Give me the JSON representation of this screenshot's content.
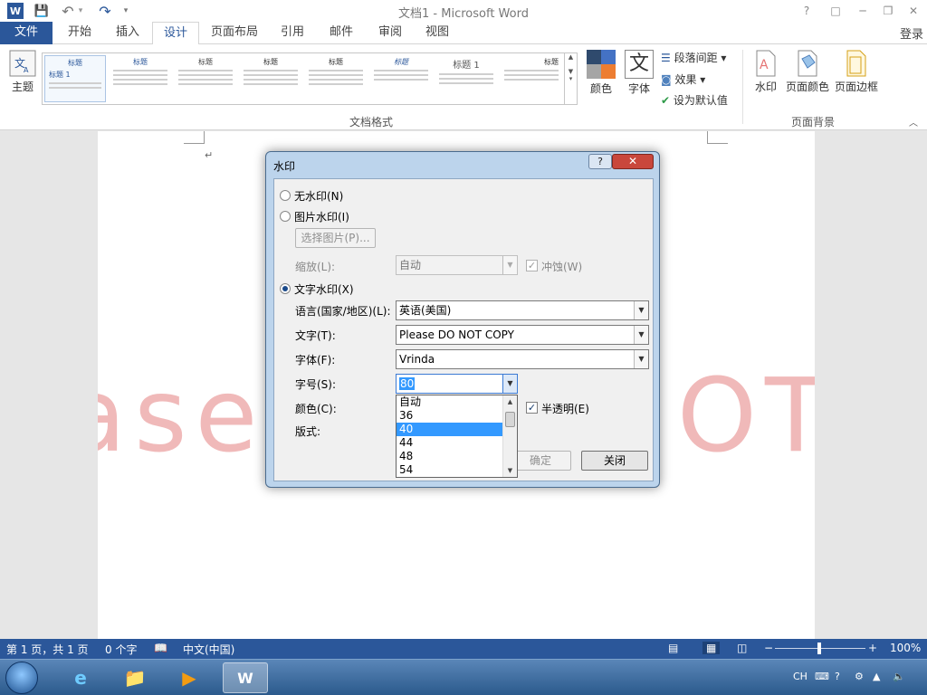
{
  "titlebar": {
    "title": "文档1 - Microsoft Word",
    "help": "?",
    "restore_ribbon": "□",
    "minimize": "─",
    "maximize": "❐",
    "close": "✕"
  },
  "qat": {
    "word_logo": "W",
    "save": "💾",
    "undo": "↶",
    "undo_drop": "▾",
    "redo": "↷",
    "customize": "▾"
  },
  "tabs": [
    "文件",
    "开始",
    "插入",
    "设计",
    "页面布局",
    "引用",
    "邮件",
    "审阅",
    "视图"
  ],
  "signin": "登录",
  "ribbon": {
    "theme_label": "主题",
    "gallery_items": [
      "标题",
      "标题 1",
      "标题",
      "标题",
      "标题",
      "标题",
      "标题",
      "标题 1",
      "标题"
    ],
    "colors_label": "颜色",
    "fonts_label": "字体",
    "fonts_glyph": "文",
    "para_spacing": "段落间距",
    "effects": "效果",
    "set_default": "设为默认值",
    "group_doc_format": "文档格式",
    "watermark_label": "水印",
    "page_color_label": "页面颜色",
    "page_border_label": "页面边框",
    "group_page_bg": "页面背景"
  },
  "document": {
    "para_mark": "↵",
    "watermark_text": "Please DO NOT COPY"
  },
  "dialog": {
    "title": "水印",
    "help": "?",
    "close": "✕",
    "no_watermark": "无水印(N)",
    "picture_watermark": "图片水印(I)",
    "select_picture": "选择图片(P)...",
    "scale_label": "缩放(L):",
    "scale_value": "自动",
    "washout_label": "冲蚀(W)",
    "text_watermark": "文字水印(X)",
    "language_label": "语言(国家/地区)(L):",
    "language_value": "英语(美国)",
    "text_label": "文字(T):",
    "text_value": "Please DO NOT COPY",
    "font_label": "字体(F):",
    "font_value": "Vrinda",
    "size_label": "字号(S):",
    "size_value": "80",
    "color_label": "颜色(C):",
    "semitransparent_label": "半透明(E)",
    "layout_label": "版式:",
    "ok": "确定",
    "cancel": "关闭",
    "size_options": [
      "自动",
      "36",
      "40",
      "44",
      "48",
      "54"
    ],
    "size_selected": "40"
  },
  "statusbar": {
    "page": "第 1 页，共 1 页",
    "words": "0 个字",
    "language": "中文(中国)",
    "zoom": "100%",
    "zoom_minus": "−",
    "zoom_plus": "+"
  },
  "taskbar": {
    "tray_lang": "CH"
  }
}
